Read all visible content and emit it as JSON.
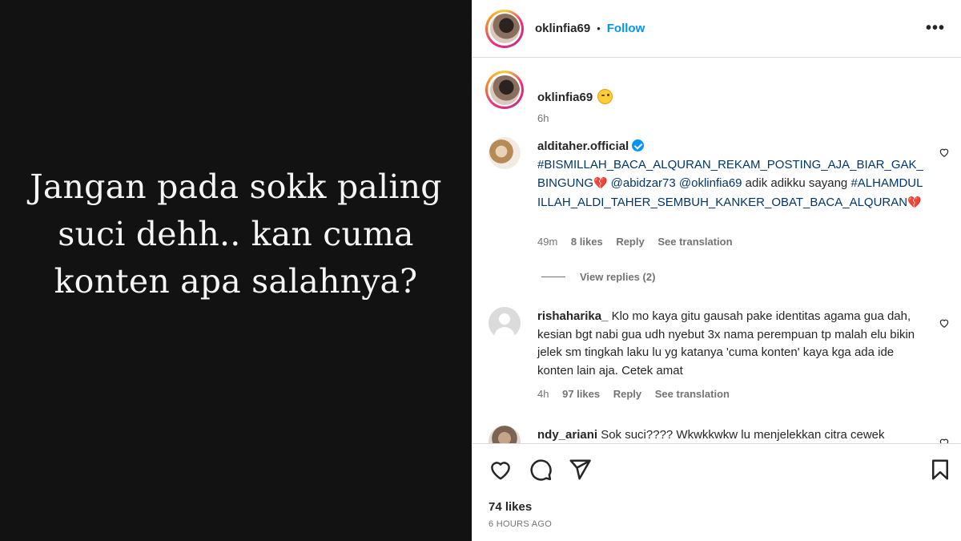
{
  "media": {
    "text": "Jangan pada sokk paling suci dehh.. kan cuma konten apa salahnya?"
  },
  "header": {
    "username": "oklinfia69",
    "separator": "•",
    "follow_label": "Follow",
    "more_icon": "more-options-icon"
  },
  "caption": {
    "username": "oklinfia69",
    "emoji": "winking-face-emoji",
    "time": "6h"
  },
  "comments": [
    {
      "username": "alditaher.official",
      "verified": true,
      "text_hashtag1": "#BISMILLAH_BACA_ALQURAN_REKAM_POSTING_AJA_BIAR_GAK_BINGUNG",
      "heart1": "💔",
      "mention1": "@abidzar73",
      "mention2": "@oklinfia69",
      "text_plain": " adik adikku sayang ",
      "text_hashtag2": "#ALHAMDULILLAH_ALDI_TAHER_SEMBUH_KANKER_OBAT_BACA_ALQURAN",
      "heart2": "💔",
      "time": "49m",
      "likes": "8 likes",
      "reply": "Reply",
      "translate": "See translation",
      "view_replies": "View replies (2)"
    },
    {
      "username": "rishaharika_",
      "text": "Klo mo kaya gitu gausah pake identitas agama gua dah, kesian bgt nabi gua udh nyebut 3x nama perempuan tp malah elu bikin jelek sm tingkah laku lu yg katanya 'cuma konten' kaya kga ada ide konten lain aja. Cetek amat",
      "time": "4h",
      "likes": "97 likes",
      "reply": "Reply",
      "translate": "See translation"
    },
    {
      "username": "ndy_ariani",
      "text": "Sok suci???? Wkwkkwkw lu menjelekkan citra cewek"
    }
  ],
  "footer": {
    "likes": "74 likes",
    "time_ago": "6 HOURS AGO"
  },
  "colors": {
    "accent": "#0095f6",
    "hashtag": "#00376b",
    "muted": "#737373",
    "media_bg": "#121212"
  }
}
